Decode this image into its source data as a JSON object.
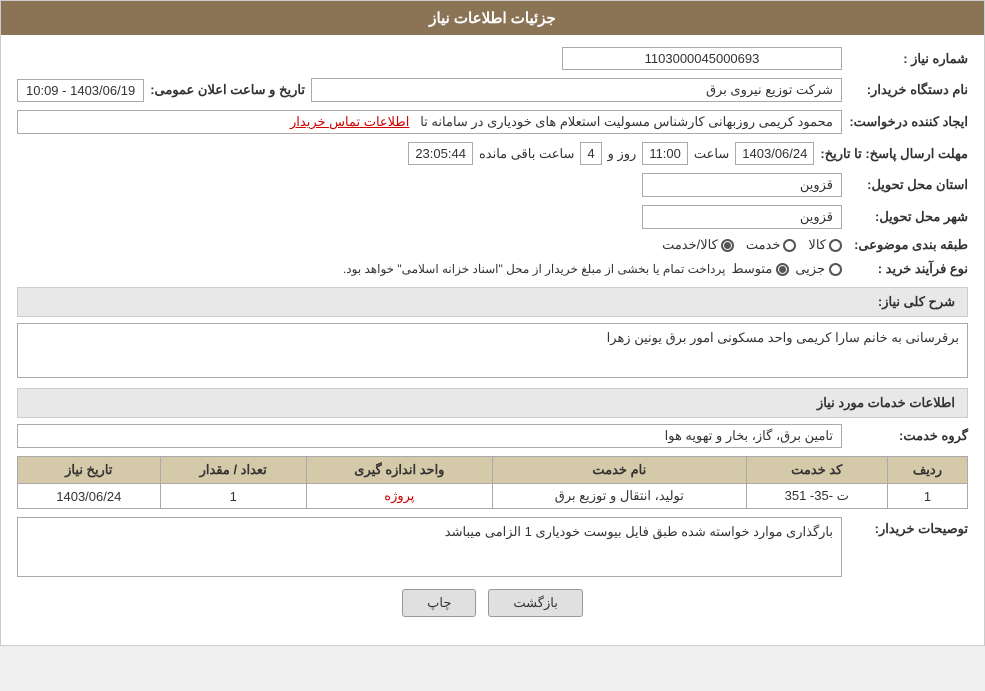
{
  "header": {
    "title": "جزئیات اطلاعات نیاز"
  },
  "fields": {
    "need_number_label": "شماره نیاز :",
    "need_number_value": "1103000045000693",
    "requester_org_label": "نام دستگاه خریدار:",
    "requester_org_value": "شرکت توزیع نیروی برق",
    "creator_label": "ایجاد کننده درخواست:",
    "creator_value": "محمود کریمی روزبهانی کارشناس  مسولیت استعلام های خودیاری در سامانه تا",
    "creator_link": "اطلاعات تماس خریدار",
    "send_date_label": "مهلت ارسال پاسخ: تا تاریخ:",
    "send_date_value": "1403/06/24",
    "send_time_label": "ساعت",
    "send_time_value": "11:00",
    "send_days_label": "روز و",
    "send_days_value": "4",
    "send_remaining_label": "ساعت باقی مانده",
    "send_remaining_value": "23:05:44",
    "province_label": "استان محل تحویل:",
    "province_value": "قزوین",
    "city_label": "شهر محل تحویل:",
    "city_value": "قزوین",
    "announce_label": "تاریخ و ساعت اعلان عمومی:",
    "announce_value": "1403/06/19 - 10:09",
    "category_label": "طبقه بندی موضوعی:",
    "category_goods": "کالا",
    "category_service": "خدمت",
    "category_goods_service": "کالا/خدمت",
    "purchase_type_label": "نوع فرآیند خرید :",
    "purchase_type_individual": "جزیی",
    "purchase_type_medium": "متوسط",
    "purchase_type_note": "پرداخت تمام یا بخشی از مبلغ خریدار از محل \"اسناد خزانه اسلامی\" خواهد بود.",
    "need_desc_label": "شرح کلی نیاز:",
    "need_desc_value": "برقرسانی به خانم سارا کریمی واحد مسکونی امور برق یونین زهرا",
    "services_section_label": "اطلاعات خدمات مورد نیاز",
    "service_group_label": "گروه خدمت:",
    "service_group_value": "تامین برق، گاز، بخار و تهویه هوا"
  },
  "table": {
    "columns": [
      "ردیف",
      "کد خدمت",
      "نام خدمت",
      "واحد اندازه گیری",
      "تعداد / مقدار",
      "تاریخ نیاز"
    ],
    "rows": [
      {
        "row": "1",
        "service_code": "ت -35- 351",
        "service_name": "تولید، انتقال و توزیع برق",
        "unit": "پروژه",
        "quantity": "1",
        "date": "1403/06/24"
      }
    ]
  },
  "buyer_desc_label": "توصیحات خریدار:",
  "buyer_desc_value": "بارگذاری موارد خواسته شده طبق فایل بیوست خودیاری 1 الزامی میباشد",
  "buttons": {
    "back_label": "بازگشت",
    "print_label": "چاپ"
  }
}
